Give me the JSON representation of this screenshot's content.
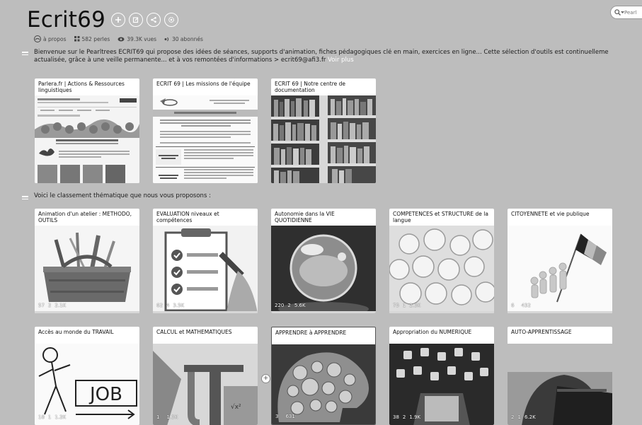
{
  "header": {
    "title": "Ecrit69",
    "stats": {
      "about": "à propos",
      "pearls": "582 perles",
      "views": "39.3K vues",
      "subscribers": "30 abonnés"
    },
    "search_placeholder": "Pearl"
  },
  "description": {
    "line1": "Bienvenue sur le Pearltrees ECRIT69 qui propose des idées de séances, supports d'animation, fiches pédagogiques clé en main, exercices en ligne... Cette sélection d'outils est continuelleme",
    "line2": "actualisée, grâce à une veille permanente... et à vos remontées d'informations > ecrit69@afi3.fr",
    "more": "Voir plus"
  },
  "top_cards": [
    {
      "title": "Parlera.fr | Actions & Ressources linguistiques"
    },
    {
      "title": "ECRIT 69 | Les missions de l'équipe"
    },
    {
      "title": "ECRIT 69 | Notre centre de documentation"
    }
  ],
  "section2_text": "Voici le classement thématique que nous vous proposons :",
  "theme_cards_row1": [
    {
      "title": "Animation d'un atelier : METHODO, OUTILS",
      "pearls": "57",
      "subs": "2",
      "views": "2.1K"
    },
    {
      "title": "EVALUATION niveaux et compétences",
      "pearls": "62",
      "subs": "4",
      "views": "3.5K"
    },
    {
      "title": "Autonomie dans la VIE QUOTIDIENNE",
      "pearls": "220",
      "subs": "2",
      "views": "5.6K"
    },
    {
      "title": "COMPETENCES et STRUCTURE de la langue",
      "pearls": "75",
      "subs": "1",
      "views": "2.3K"
    },
    {
      "title": "CITOYENNETE et vie publique",
      "pearls": "6",
      "subs": "",
      "views": "432"
    }
  ],
  "theme_cards_row2": [
    {
      "title": "Accès au monde du TRAVAIL",
      "pearls": "18",
      "subs": "1",
      "views": "1.2K"
    },
    {
      "title": "CALCUL et MATHEMATIQUES",
      "pearls": "1",
      "subs": "",
      "views": "1.3K"
    },
    {
      "title": "APPRENDRE à APPRENDRE",
      "pearls": "3",
      "subs": "",
      "views": "631"
    },
    {
      "title": "Appropriation du NUMERIQUE",
      "pearls": "38",
      "subs": "2",
      "views": "1.9K"
    },
    {
      "title": "AUTO-APPRENTISSAGE",
      "pearls": "2",
      "subs": "1",
      "views": "6.2K"
    }
  ],
  "job_text": "JOB"
}
